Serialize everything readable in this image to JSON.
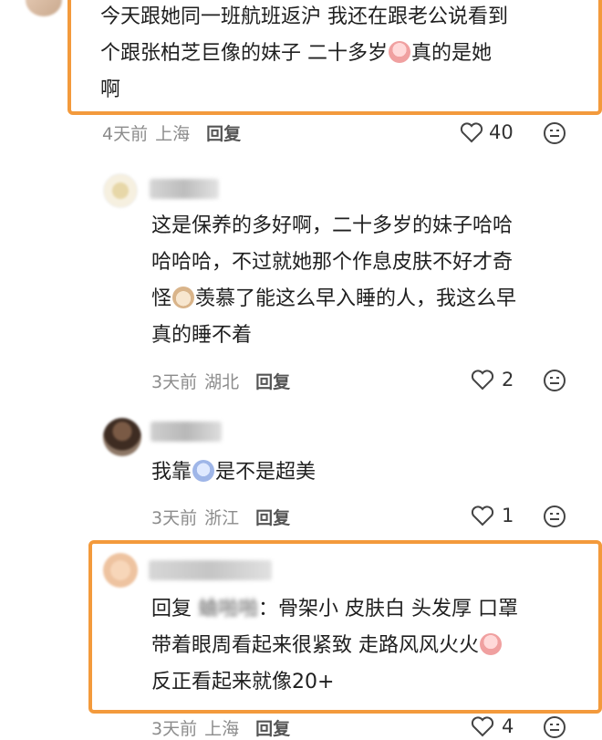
{
  "comments": [
    {
      "text_before": "今天跟她同一班航班返沪 我还在跟老公说看到",
      "line2_a": "个跟张柏芝巨像的妹子 二十多岁",
      "line2_emoji": "crying-emoji",
      "line2_b": "真的是她",
      "line3": "啊",
      "time": "4天前",
      "location": "上海",
      "reply_label": "回复",
      "likes": "40"
    },
    {
      "line1": "这是保养的多好啊，二十多岁的妹子哈哈",
      "line2": "哈哈哈，不过就她那个作息皮肤不好才奇",
      "line3_a": "怪",
      "line3_emoji": "cat-emoji",
      "line3_b": "羡慕了能这么早入睡的人，我这么早",
      "line4": "真的睡不着",
      "time": "3天前",
      "location": "湖北",
      "reply_label": "回复",
      "likes": "2"
    },
    {
      "text_a": "我靠",
      "text_emoji": "shocked-emoji",
      "text_b": "是不是超美",
      "time": "3天前",
      "location": "浙江",
      "reply_label": "回复",
      "likes": "1"
    },
    {
      "reply_prefix": "回复",
      "masked_name": "蛐啪啪",
      "line1_b": "：骨架小 皮肤白 头发厚 口罩",
      "line2_a": "带着眼周看起来很紧致 走路风风火火",
      "line2_emoji": "crying-emoji",
      "line3": "反正看起来就像20+",
      "time": "3天前",
      "location": "上海",
      "reply_label": "回复",
      "likes": "4"
    }
  ],
  "colors": {
    "highlight": "#f39a3c",
    "meta_text": "#8c8c8c"
  },
  "icons": [
    "heart-icon",
    "emoji-reaction-icon"
  ]
}
